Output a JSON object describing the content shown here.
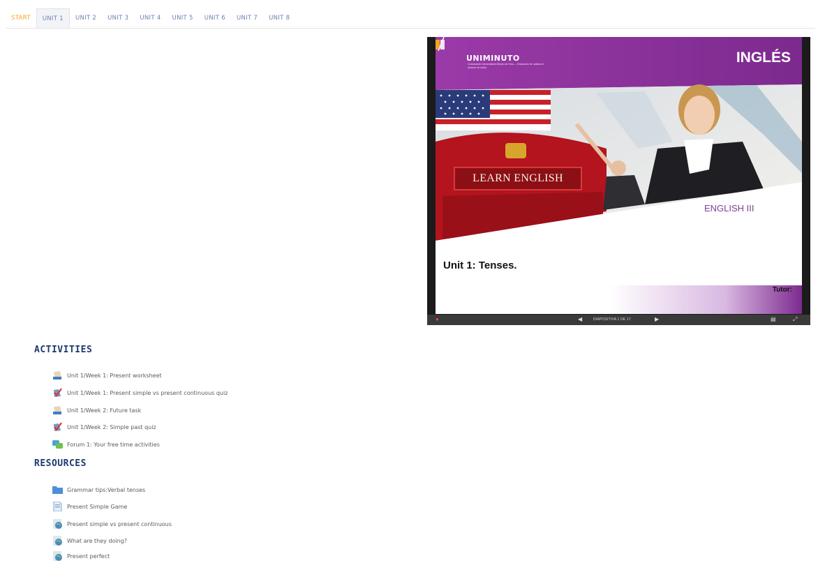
{
  "tabs": [
    "START",
    "UNIT 1",
    "UNIT 2",
    "UNIT 3",
    "UNIT 4",
    "UNIT 5",
    "UNIT 6",
    "UNIT 7",
    "UNIT 8"
  ],
  "slide": {
    "logo": "UNIMINUTO",
    "logo_sub": "Corporación Universitaria Minuto de Dios — Educación de calidad al alcance de todos",
    "title": "INGLÉS",
    "sign": "LEARN ENGLISH",
    "subtitle": "ENGLISH III",
    "unit": "Unit 1: Tenses.",
    "tutor": "Tutor:",
    "counter": "DIAPOSITIVA 1 DE 17"
  },
  "activities": {
    "heading": "ACTIVITIES",
    "items": [
      {
        "label": "Unit 1/Week 1: Present worksheet",
        "icon": "assignment-icon"
      },
      {
        "label": "Unit 1/Week 1: Present simple vs present continuous quiz",
        "icon": "quiz-icon"
      },
      {
        "label": "Unit 1/Week 2: Future task",
        "icon": "assignment-icon"
      },
      {
        "label": "Unit 1/Week 2: Simple past quiz",
        "icon": "quiz-icon"
      },
      {
        "label": "Forum 1: Your free time activities",
        "icon": "forum-icon"
      }
    ]
  },
  "resources": {
    "heading": "RESOURCES",
    "items": [
      {
        "label": "Grammar tips:Verbal tenses",
        "icon": "folder-icon"
      },
      {
        "label": "Present Simple Game",
        "icon": "page-icon"
      },
      {
        "label": "Present simple vs present continuous",
        "icon": "url-globe-icon"
      },
      {
        "label": "What are they doing?",
        "icon": "url-globe-icon"
      },
      {
        "label": "Present perfect",
        "icon": "url-globe-icon"
      }
    ]
  },
  "colors": {
    "tab_start": "#f5a623",
    "tab_text": "#6a7fb0",
    "heading": "#1c3a6e",
    "slide_purple": "#8a2f9a"
  }
}
